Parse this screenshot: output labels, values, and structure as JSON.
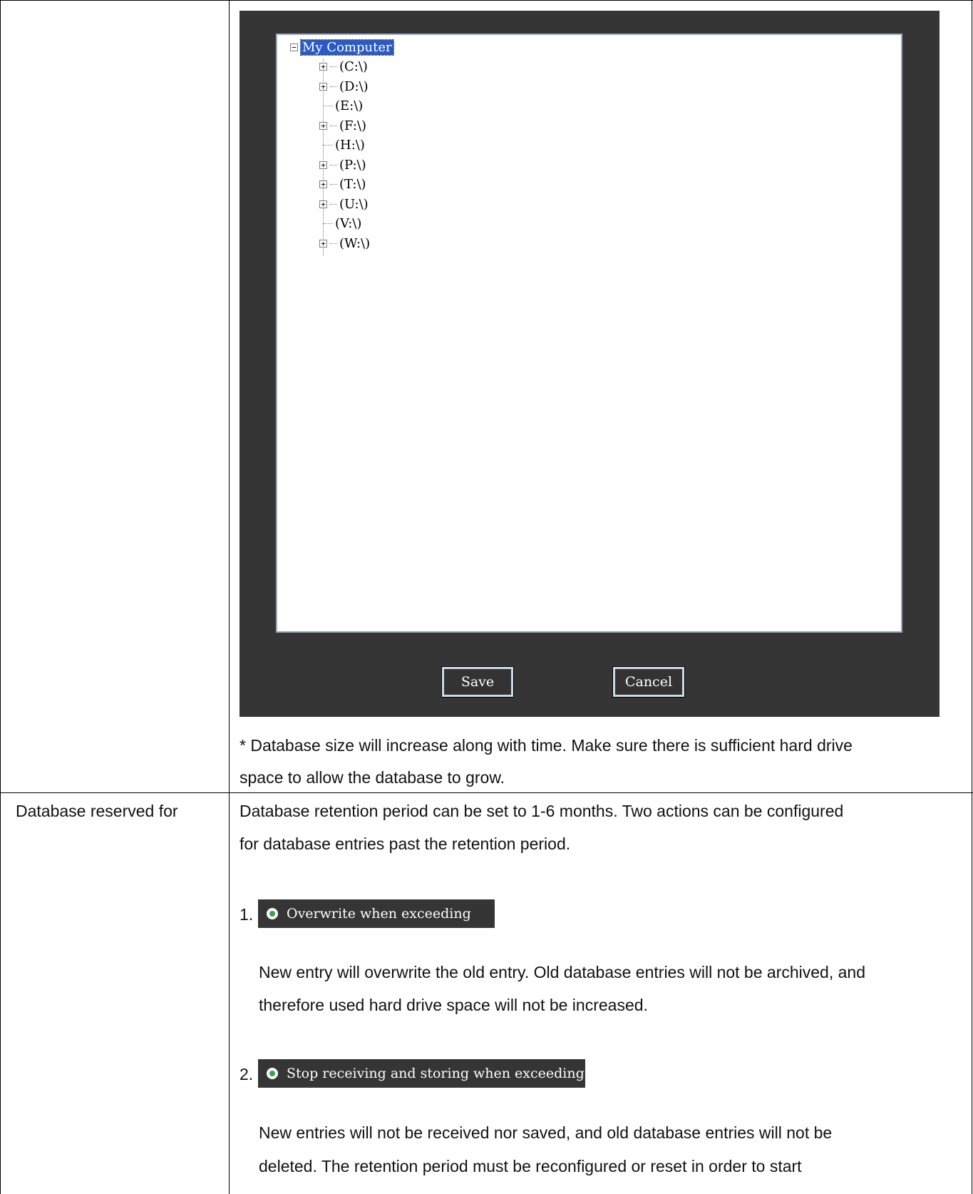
{
  "top_row": {
    "dialog": {
      "tree": {
        "root": "My Computer",
        "drives": [
          {
            "label": "(C:\\)",
            "expandable": true
          },
          {
            "label": "(D:\\)",
            "expandable": true
          },
          {
            "label": "(E:\\)",
            "expandable": false
          },
          {
            "label": "(F:\\)",
            "expandable": true
          },
          {
            "label": "(H:\\)",
            "expandable": false
          },
          {
            "label": "(P:\\)",
            "expandable": true
          },
          {
            "label": "(T:\\)",
            "expandable": true
          },
          {
            "label": "(U:\\)",
            "expandable": true
          },
          {
            "label": "(V:\\)",
            "expandable": false
          },
          {
            "label": "(W:\\)",
            "expandable": true
          }
        ]
      },
      "save_label": "Save",
      "cancel_label": "Cancel"
    },
    "note_line1": "* Database size will increase along with time. Make sure there is sufficient hard drive",
    "note_line2": "space to allow the database to grow."
  },
  "bottom_row": {
    "label": "Database reserved for",
    "intro_line1": "Database retention period can be set to 1-6 months. Two actions can be configured",
    "intro_line2": "for database entries past the retention period.",
    "options": [
      {
        "number": "1.",
        "radio_label": "Overwrite when exceeding",
        "desc_line1": "New entry will overwrite the old entry. Old database entries will not be archived, and",
        "desc_line2": "therefore used hard drive space will not be increased."
      },
      {
        "number": "2.",
        "radio_label": "Stop receiving and storing when exceeding",
        "desc_line1": "New entries will not be received nor saved, and old database entries will not be",
        "desc_line2": "deleted. The retention period must be reconfigured or reset in order to start"
      }
    ]
  }
}
